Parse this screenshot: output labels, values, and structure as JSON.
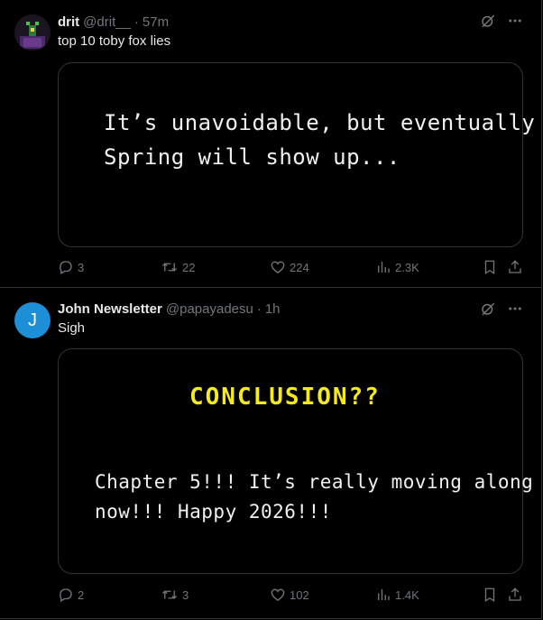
{
  "tweets": [
    {
      "author": {
        "name": "drit",
        "handle": "@drit__",
        "time": "57m"
      },
      "text": "top 10 toby fox lies",
      "media": {
        "lines": [
          "It’s unavoidable, but eventually",
          "Spring will show up..."
        ]
      },
      "stats": {
        "replies": "3",
        "retweets": "22",
        "likes": "224",
        "views": "2.3K"
      }
    },
    {
      "author": {
        "name": "John Newsletter",
        "handle": "@papayadesu",
        "time": "1h",
        "avatar_letter": "J"
      },
      "text": "Sigh",
      "media": {
        "heading": "CONCLUSION??",
        "heading_color": "#f4ea1c",
        "lines": [
          "Chapter 5!!! It’s really moving along",
          "now!!! Happy 2026!!!"
        ]
      },
      "stats": {
        "replies": "2",
        "retweets": "3",
        "likes": "102",
        "views": "1.4K"
      }
    }
  ],
  "colors": {
    "background": "#000000",
    "text": "#e7e9ea",
    "muted": "#71767b",
    "border": "#2f3336",
    "avatar_blue": "#1d8fd8"
  },
  "icons": {
    "grok": "grok-icon",
    "more": "more-icon",
    "reply": "reply-icon",
    "retweet": "retweet-icon",
    "like": "like-icon",
    "views": "views-icon",
    "bookmark": "bookmark-icon",
    "share": "share-icon"
  }
}
